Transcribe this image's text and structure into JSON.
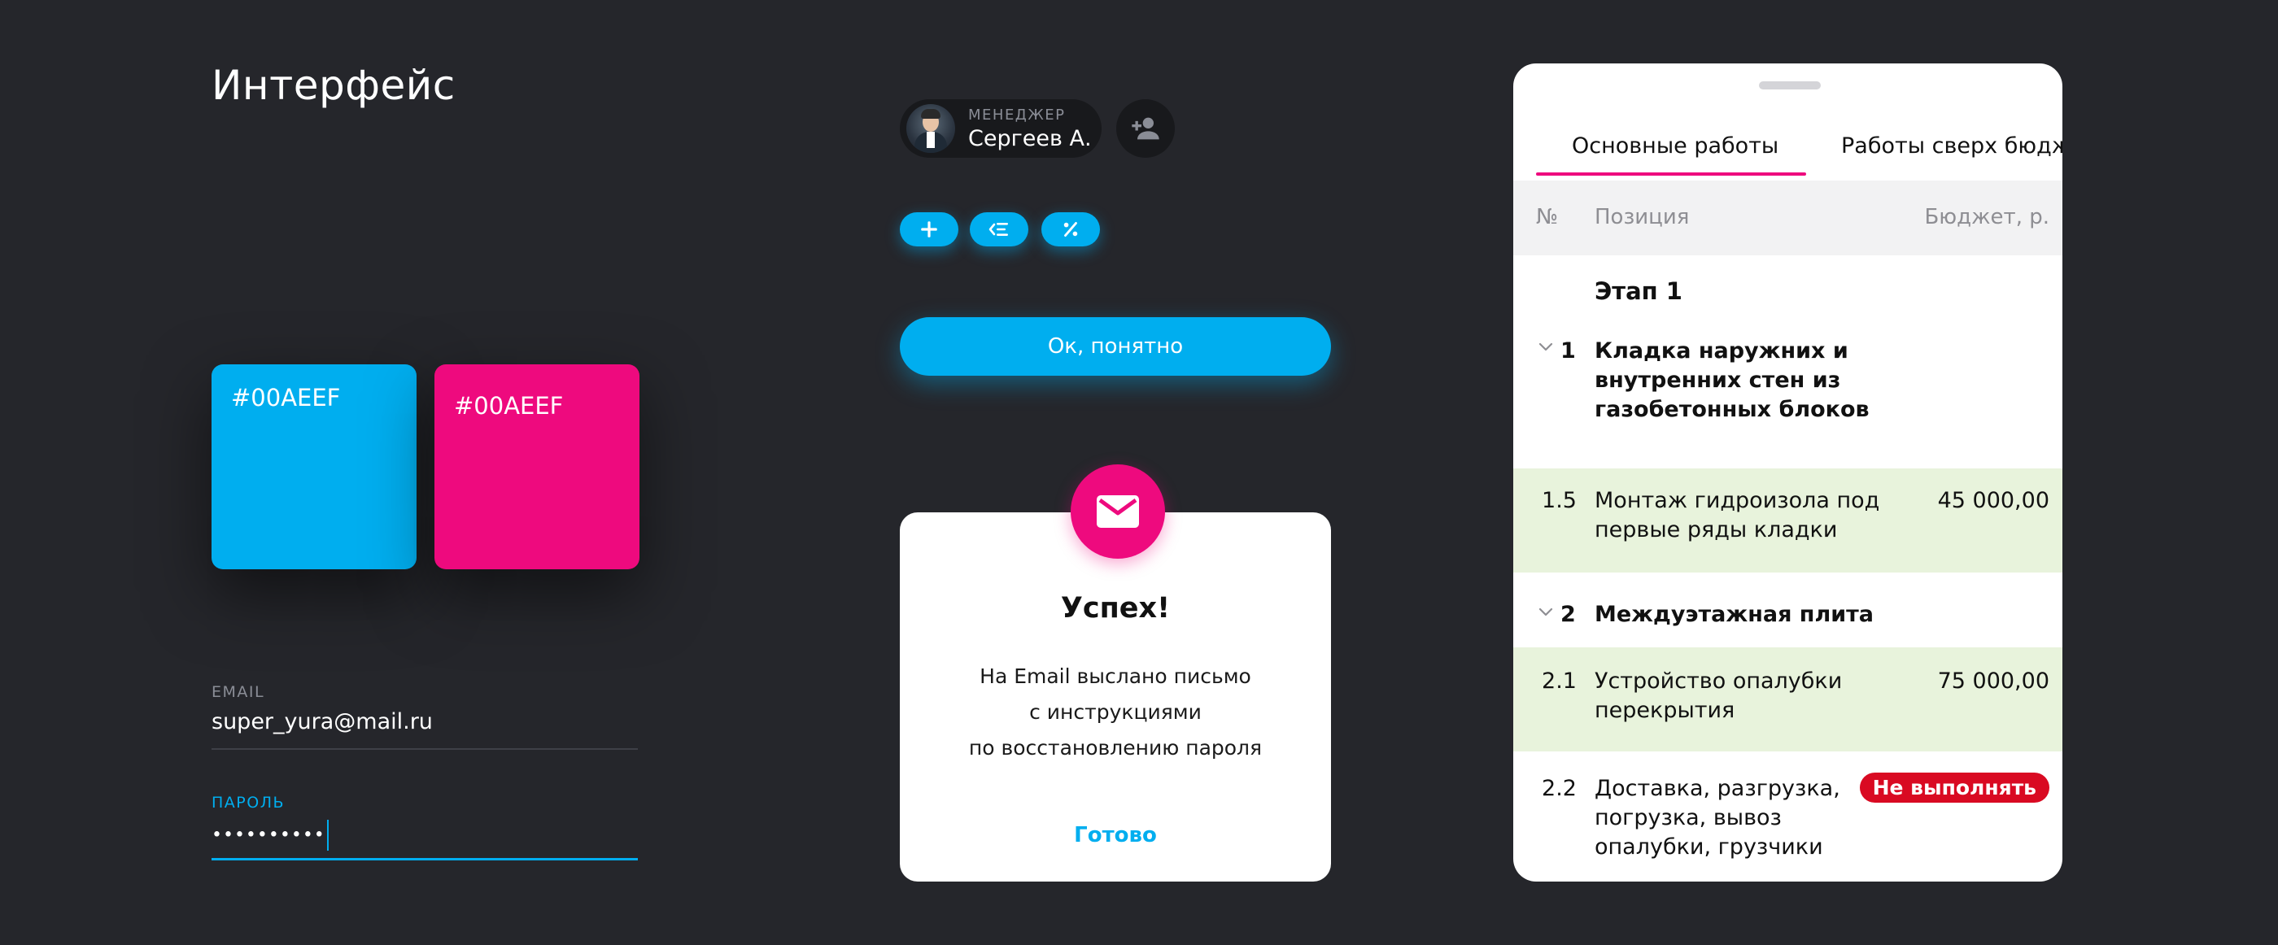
{
  "page": {
    "title": "Интерфейс"
  },
  "swatches": [
    {
      "label": "#00AEEF",
      "color": "#00AEEF"
    },
    {
      "label": "#00AEEF",
      "color": "#EE0A7E"
    }
  ],
  "form": {
    "email": {
      "label": "EMAIL",
      "value": "super_yura@mail.ru"
    },
    "password": {
      "label": "ПАРОЛЬ",
      "value": "••••••••••"
    }
  },
  "manager": {
    "role": "МЕНЕДЖЕР",
    "name": "Сергеев А."
  },
  "icons": {
    "add_user": "add-user-icon",
    "plus": "plus-icon",
    "indent": "outdent-icon",
    "percent": "percent-icon",
    "mail": "mail-icon",
    "chevron": "chevron-down-icon"
  },
  "ok_button": {
    "label": "Ок, понятно"
  },
  "success": {
    "title": "Успех!",
    "message_lines": [
      "На Email выслано письмо",
      "с инструкциями",
      "по восстановлению пароля"
    ],
    "done_label": "Готово"
  },
  "sheet": {
    "tabs": [
      {
        "label": "Основные работы",
        "active": true
      },
      {
        "label": "Работы сверх бюджета",
        "active": false
      }
    ],
    "columns": {
      "num": "№",
      "position": "Позиция",
      "budget": "Бюджет, р."
    },
    "stage": {
      "label": "Этап 1"
    },
    "rows": [
      {
        "num": "1",
        "position_lines": [
          "Кладка наружних и",
          "внутренних стен из",
          "газобетонных блоков"
        ],
        "budget": "",
        "type": "group"
      },
      {
        "num": "1.5",
        "position_lines": [
          "Монтаж гидроизола под",
          "первые ряды кладки"
        ],
        "budget": "45 000,00",
        "type": "item"
      },
      {
        "num": "2",
        "position_lines": [
          "Междуэтажная плита"
        ],
        "budget": "",
        "type": "group"
      },
      {
        "num": "2.1",
        "position_lines": [
          "Устройство опалубки",
          "перекрытия"
        ],
        "budget": "75 000,00",
        "type": "item"
      },
      {
        "num": "2.2",
        "position_lines": [
          "Доставка, разгрузка,",
          "погрузка, вывоз",
          "опалубки, грузчики"
        ],
        "budget": "",
        "badge": "Не выполнять",
        "type": "plain"
      }
    ]
  },
  "colors": {
    "background": "#25262B",
    "primary": "#00AEEF",
    "accent": "#EE0A7E",
    "done_row": "#E8F3DC",
    "danger": "#D90A22"
  }
}
